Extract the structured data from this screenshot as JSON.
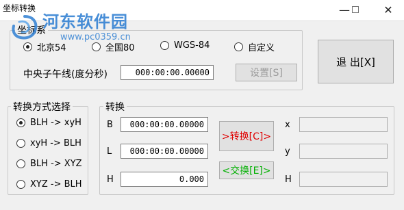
{
  "window": {
    "title": "坐标转换",
    "minimize_icon": "minimize-icon",
    "maximize_icon": "maximize-icon",
    "close_icon": "close-icon"
  },
  "watermark": {
    "text": "河东软件园",
    "url": "www.pc0359.cn"
  },
  "coord_system": {
    "legend": "坐标系",
    "options": [
      "北京54",
      "全国80",
      "WGS-84",
      "自定义"
    ],
    "selected": "北京54",
    "meridian_label": "中央子午线(度分秒)",
    "meridian_value": "000:00:00.00000",
    "settings_button": "设置[S]"
  },
  "exit_button": "退 出[X]",
  "method": {
    "legend": "转换方式选择",
    "options": [
      "BLH -> xyH",
      "xyH -> BLH",
      "BLH -> XYZ",
      "XYZ -> BLH"
    ],
    "selected": "BLH -> xyH"
  },
  "convert": {
    "legend": "转换",
    "B_label": "B",
    "B_value": "000:00:00.00000",
    "L_label": "L",
    "L_value": "000:00:00.00000",
    "H_label": "H",
    "H_value": "0.000",
    "convert_button": ">转换[C]>",
    "swap_button": "<交换[E]>",
    "x_label": "x",
    "y_label": "y",
    "h_label": "H",
    "x_value": "",
    "y_value": "",
    "h_value": ""
  },
  "colors": {
    "convert_button_text": "#e00000",
    "swap_button_text": "#00b000",
    "watermark": "#2f7fd2"
  }
}
